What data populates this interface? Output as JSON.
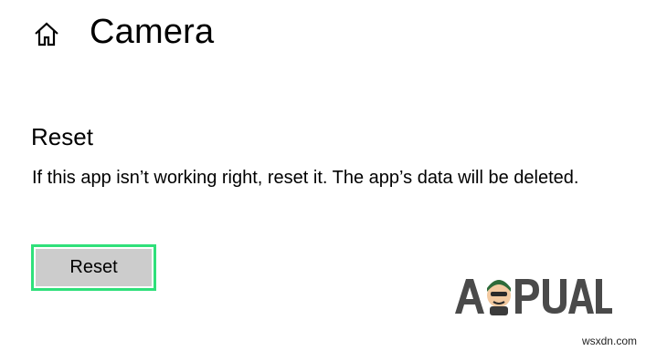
{
  "header": {
    "home_icon": "home-icon",
    "title": "Camera"
  },
  "reset_section": {
    "heading": "Reset",
    "description": "If this app isn’t working right, reset it. The app’s data will be deleted.",
    "button_label": "Reset",
    "button_highlight_color": "#2fe07a"
  },
  "watermark": {
    "logo_text": "APPUALS",
    "site_url": "wsxdn.com"
  }
}
